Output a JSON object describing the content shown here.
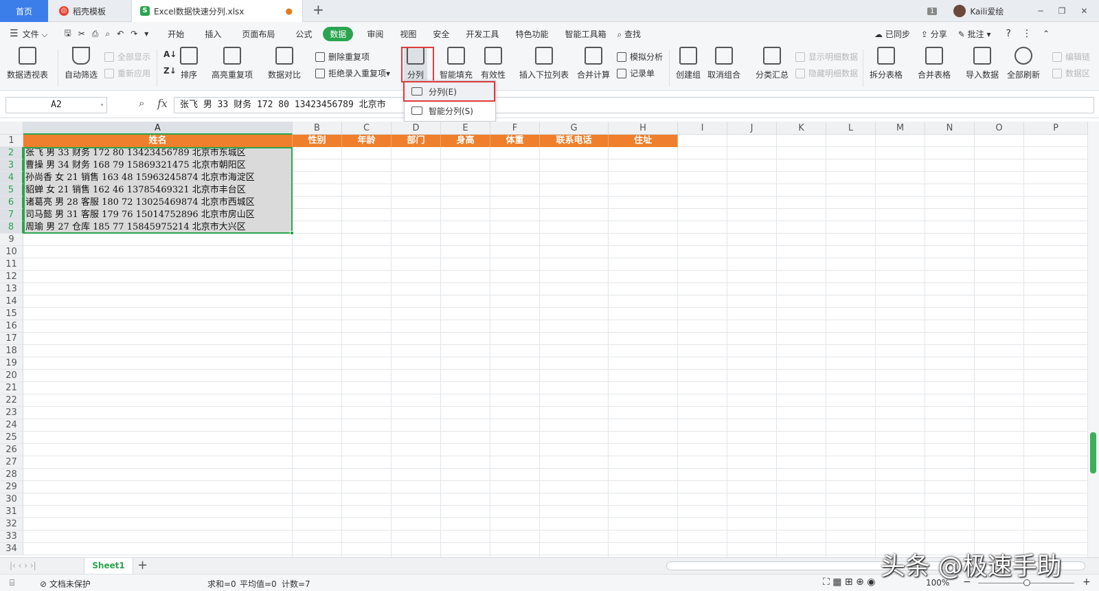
{
  "tabs": {
    "home": "首页",
    "template": "稻壳模板",
    "file": "Excel数据快速分列.xlsx",
    "new_tab": "+"
  },
  "titlebar": {
    "badge": "1",
    "user": "Kaili爱绘"
  },
  "menu": {
    "file": "文件",
    "items": [
      "开始",
      "插入",
      "页面布局",
      "公式",
      "数据",
      "审阅",
      "视图",
      "安全",
      "开发工具",
      "特色功能",
      "智能工具箱"
    ],
    "active": "数据",
    "search": "查找",
    "sync": "已同步",
    "share": "分享",
    "comment": "批注"
  },
  "ribbon": {
    "pivot": "数据透视表",
    "autofilter": "自动筛选",
    "show_all": "全部显示",
    "reapply": "重新应用",
    "sort": "排序",
    "highlight_dup": "高亮重复项",
    "compare": "数据对比",
    "delete_dup": "删除重复项",
    "reject_dup": "拒绝录入重复项",
    "split": "分列",
    "smart_fill": "智能填充",
    "validity": "有效性",
    "dropdown_list": "插入下拉列表",
    "consolidate": "合并计算",
    "simulate": "模拟分析",
    "record": "记录单",
    "create_group": "创建组",
    "ungroup": "取消组合",
    "subtotal": "分类汇总",
    "show_detail": "显示明细数据",
    "hide_detail": "隐藏明细数据",
    "split_table": "拆分表格",
    "merge_table": "合并表格",
    "import": "导入数据",
    "refresh_all": "全部刷新",
    "edit_link": "编辑链",
    "data_more": "数据区"
  },
  "dropdown": {
    "item1": "分列(E)",
    "item2": "智能分列(S)"
  },
  "formula": {
    "cell_ref": "A2",
    "fx": "fx",
    "content": "张飞 男 33 财务 172 80 13423456789 北京市"
  },
  "columns": [
    "A",
    "B",
    "C",
    "D",
    "E",
    "F",
    "G",
    "H",
    "I",
    "J",
    "K",
    "L",
    "M",
    "N",
    "O",
    "P"
  ],
  "header_row": [
    "姓名",
    "性别",
    "年龄",
    "部门",
    "身高",
    "体重",
    "联系电话",
    "住址"
  ],
  "rows": [
    "张飞 男 33 财务 172 80 13423456789 北京市东城区",
    "曹操 男 34 财务 168 79 15869321475 北京市朝阳区",
    "孙尚香 女 21 销售 163 48 15963245874 北京市海淀区",
    "貂蝉 女 21 销售 162 46 13785469321 北京市丰台区",
    "诸葛亮 男 28 客服 180 72 13025469874 北京市西城区",
    "司马懿 男 31 客服 179 76 15014752896 北京市房山区",
    "周瑜 男 27 仓库 185 77 15845975214 北京市大兴区"
  ],
  "row_numbers": [
    "1",
    "2",
    "3",
    "4",
    "5",
    "6",
    "7",
    "8",
    "9",
    "10",
    "11",
    "12",
    "13",
    "14",
    "15",
    "16",
    "17",
    "18",
    "19",
    "20",
    "21",
    "22",
    "23",
    "24",
    "25",
    "26",
    "27",
    "28",
    "29",
    "30",
    "31",
    "32",
    "33",
    "34"
  ],
  "sheet": {
    "name": "Sheet1",
    "add": "+"
  },
  "status": {
    "protect": "文档未保护",
    "sum": "求和=0",
    "avg": "平均值=0",
    "count": "计数=7",
    "zoom": "100%"
  },
  "watermark": "头条 @极速手助",
  "colors": {
    "accent": "#2aa44f",
    "header_fill": "#ef7f2c",
    "tab_home": "#3b7de9",
    "highlight": "#e03b3b"
  }
}
